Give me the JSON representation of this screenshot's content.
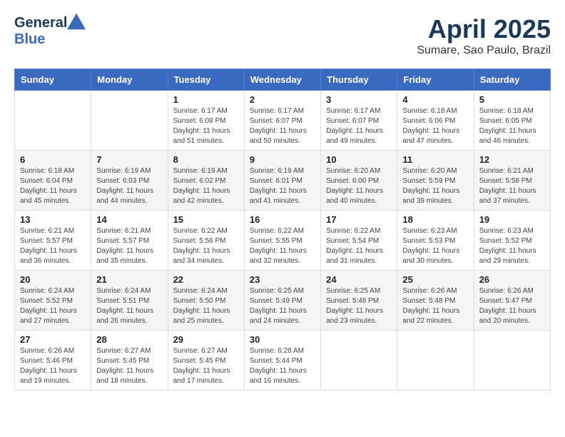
{
  "header": {
    "logo_general": "General",
    "logo_blue": "Blue",
    "month_title": "April 2025",
    "location": "Sumare, Sao Paulo, Brazil"
  },
  "days_of_week": [
    "Sunday",
    "Monday",
    "Tuesday",
    "Wednesday",
    "Thursday",
    "Friday",
    "Saturday"
  ],
  "weeks": [
    [
      {
        "day": "",
        "info": ""
      },
      {
        "day": "",
        "info": ""
      },
      {
        "day": "1",
        "info": "Sunrise: 6:17 AM\nSunset: 6:08 PM\nDaylight: 11 hours\nand 51 minutes."
      },
      {
        "day": "2",
        "info": "Sunrise: 6:17 AM\nSunset: 6:07 PM\nDaylight: 11 hours\nand 50 minutes."
      },
      {
        "day": "3",
        "info": "Sunrise: 6:17 AM\nSunset: 6:07 PM\nDaylight: 11 hours\nand 49 minutes."
      },
      {
        "day": "4",
        "info": "Sunrise: 6:18 AM\nSunset: 6:06 PM\nDaylight: 11 hours\nand 47 minutes."
      },
      {
        "day": "5",
        "info": "Sunrise: 6:18 AM\nSunset: 6:05 PM\nDaylight: 11 hours\nand 46 minutes."
      }
    ],
    [
      {
        "day": "6",
        "info": "Sunrise: 6:18 AM\nSunset: 6:04 PM\nDaylight: 11 hours\nand 45 minutes."
      },
      {
        "day": "7",
        "info": "Sunrise: 6:19 AM\nSunset: 6:03 PM\nDaylight: 11 hours\nand 44 minutes."
      },
      {
        "day": "8",
        "info": "Sunrise: 6:19 AM\nSunset: 6:02 PM\nDaylight: 11 hours\nand 42 minutes."
      },
      {
        "day": "9",
        "info": "Sunrise: 6:19 AM\nSunset: 6:01 PM\nDaylight: 11 hours\nand 41 minutes."
      },
      {
        "day": "10",
        "info": "Sunrise: 6:20 AM\nSunset: 6:00 PM\nDaylight: 11 hours\nand 40 minutes."
      },
      {
        "day": "11",
        "info": "Sunrise: 6:20 AM\nSunset: 5:59 PM\nDaylight: 11 hours\nand 39 minutes."
      },
      {
        "day": "12",
        "info": "Sunrise: 6:21 AM\nSunset: 5:58 PM\nDaylight: 11 hours\nand 37 minutes."
      }
    ],
    [
      {
        "day": "13",
        "info": "Sunrise: 6:21 AM\nSunset: 5:57 PM\nDaylight: 11 hours\nand 36 minutes."
      },
      {
        "day": "14",
        "info": "Sunrise: 6:21 AM\nSunset: 5:57 PM\nDaylight: 11 hours\nand 35 minutes."
      },
      {
        "day": "15",
        "info": "Sunrise: 6:22 AM\nSunset: 5:56 PM\nDaylight: 11 hours\nand 34 minutes."
      },
      {
        "day": "16",
        "info": "Sunrise: 6:22 AM\nSunset: 5:55 PM\nDaylight: 11 hours\nand 32 minutes."
      },
      {
        "day": "17",
        "info": "Sunrise: 6:22 AM\nSunset: 5:54 PM\nDaylight: 11 hours\nand 31 minutes."
      },
      {
        "day": "18",
        "info": "Sunrise: 6:23 AM\nSunset: 5:53 PM\nDaylight: 11 hours\nand 30 minutes."
      },
      {
        "day": "19",
        "info": "Sunrise: 6:23 AM\nSunset: 5:52 PM\nDaylight: 11 hours\nand 29 minutes."
      }
    ],
    [
      {
        "day": "20",
        "info": "Sunrise: 6:24 AM\nSunset: 5:52 PM\nDaylight: 11 hours\nand 27 minutes."
      },
      {
        "day": "21",
        "info": "Sunrise: 6:24 AM\nSunset: 5:51 PM\nDaylight: 11 hours\nand 26 minutes."
      },
      {
        "day": "22",
        "info": "Sunrise: 6:24 AM\nSunset: 5:50 PM\nDaylight: 11 hours\nand 25 minutes."
      },
      {
        "day": "23",
        "info": "Sunrise: 6:25 AM\nSunset: 5:49 PM\nDaylight: 11 hours\nand 24 minutes."
      },
      {
        "day": "24",
        "info": "Sunrise: 6:25 AM\nSunset: 5:48 PM\nDaylight: 11 hours\nand 23 minutes."
      },
      {
        "day": "25",
        "info": "Sunrise: 6:26 AM\nSunset: 5:48 PM\nDaylight: 11 hours\nand 22 minutes."
      },
      {
        "day": "26",
        "info": "Sunrise: 6:26 AM\nSunset: 5:47 PM\nDaylight: 11 hours\nand 20 minutes."
      }
    ],
    [
      {
        "day": "27",
        "info": "Sunrise: 6:26 AM\nSunset: 5:46 PM\nDaylight: 11 hours\nand 19 minutes."
      },
      {
        "day": "28",
        "info": "Sunrise: 6:27 AM\nSunset: 5:45 PM\nDaylight: 11 hours\nand 18 minutes."
      },
      {
        "day": "29",
        "info": "Sunrise: 6:27 AM\nSunset: 5:45 PM\nDaylight: 11 hours\nand 17 minutes."
      },
      {
        "day": "30",
        "info": "Sunrise: 6:28 AM\nSunset: 5:44 PM\nDaylight: 11 hours\nand 16 minutes."
      },
      {
        "day": "",
        "info": ""
      },
      {
        "day": "",
        "info": ""
      },
      {
        "day": "",
        "info": ""
      }
    ]
  ]
}
